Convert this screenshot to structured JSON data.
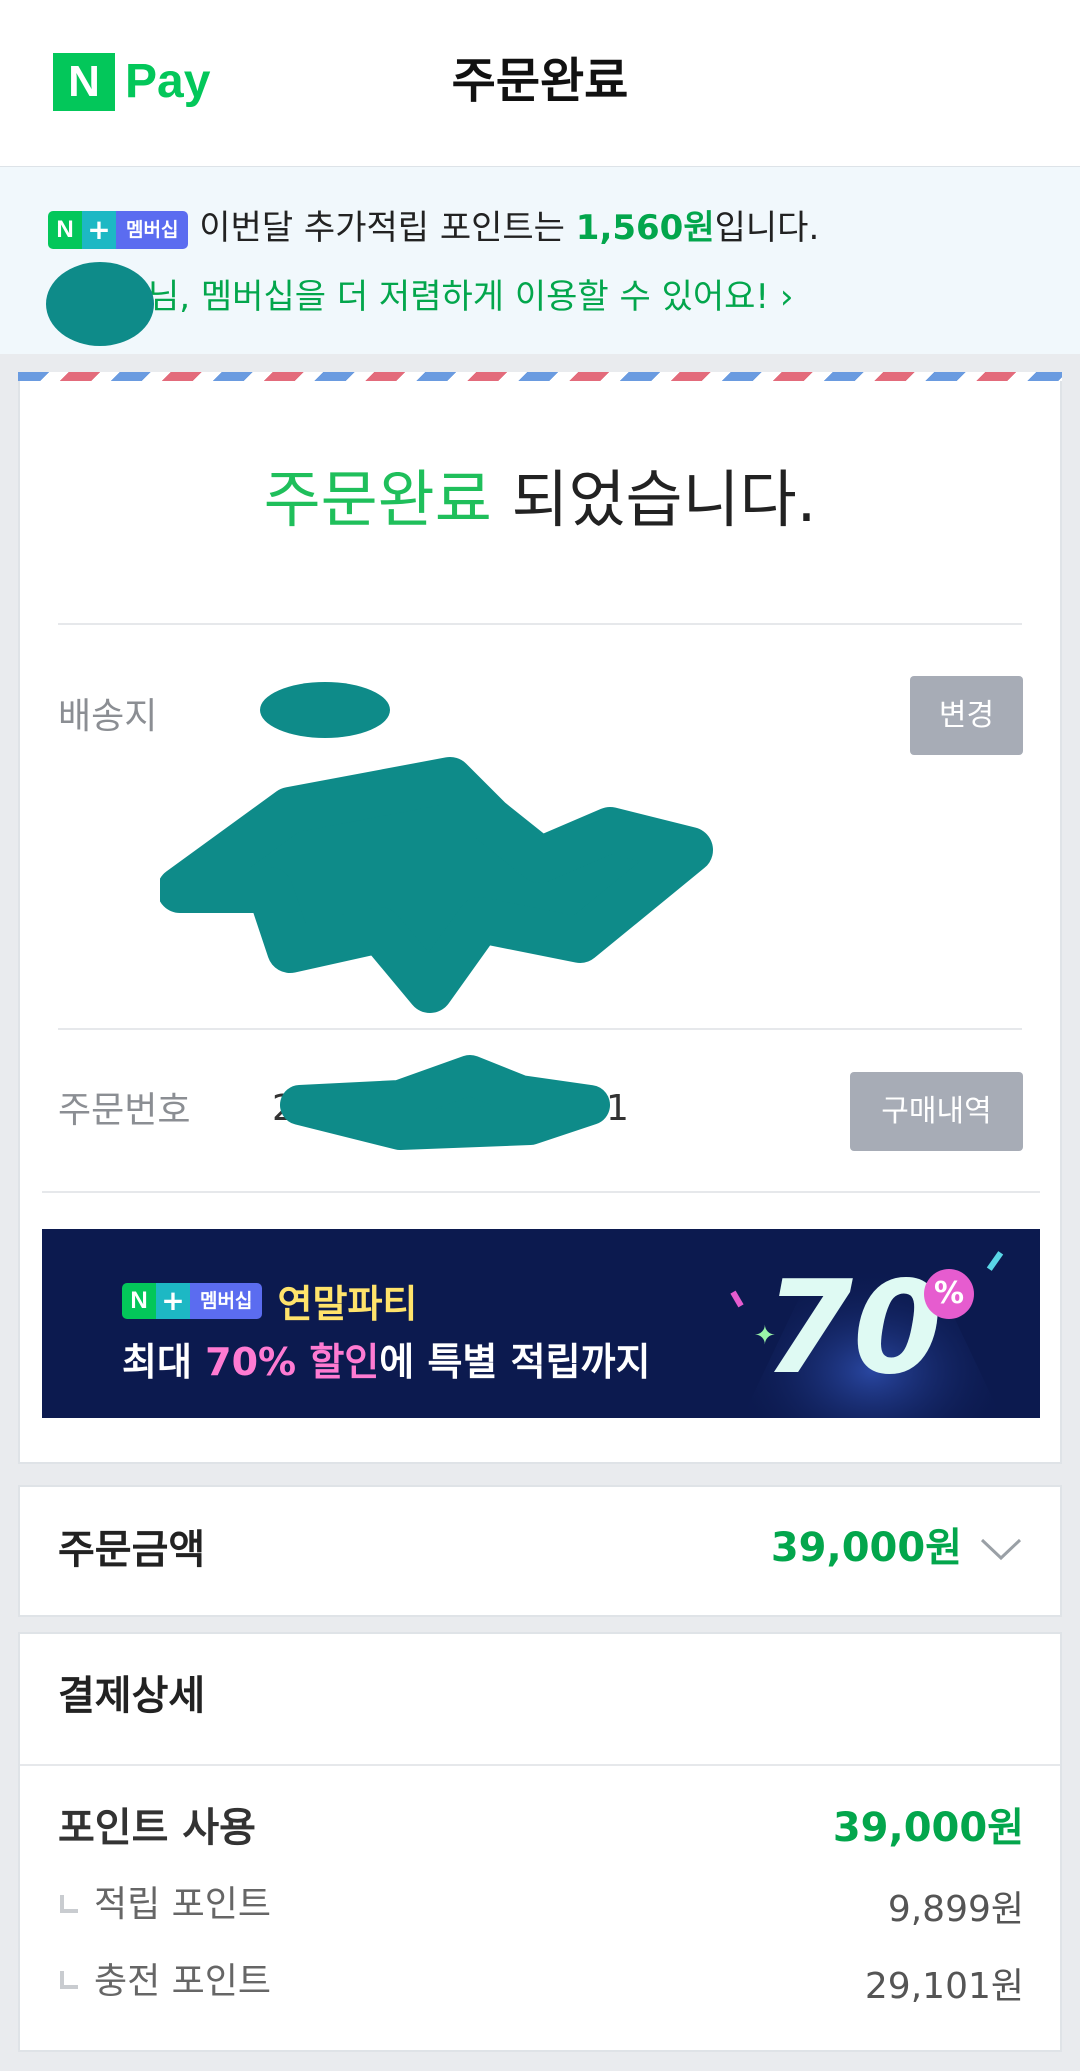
{
  "header": {
    "logo_n": "N",
    "logo_text": "Pay",
    "title": "주문완료"
  },
  "membership": {
    "badge_n": "N",
    "badge_plus": "+",
    "badge_label": "멤버십",
    "points_text_before": "이번달 추가적립 포인트는 ",
    "points_amount": "1,560원",
    "points_text_after": "입니다.",
    "link_text": "님, 멤버십을 더 저렴하게 이용할 수 있어요! ›"
  },
  "order": {
    "title_highlight": "주문완료",
    "title_rest": " 되었습니다.",
    "address_label": "배송지",
    "change_button": "변경",
    "order_number_label": "주문번호",
    "order_number_visible_start": "2",
    "order_number_visible_end": "1",
    "history_button": "구매내역"
  },
  "ad_banner": {
    "badge_n": "N",
    "badge_plus": "+",
    "badge_label": "멤버십",
    "title": "연말파티",
    "line_part1": "최대 ",
    "line_highlight": "70% 할인",
    "line_part2": "에 특별 적립까지",
    "big_number": "70",
    "percent_badge": "%"
  },
  "order_amount": {
    "label": "주문금액",
    "value": "39,000원"
  },
  "payment_detail": {
    "title": "결제상세",
    "points_used_label": "포인트 사용",
    "points_used_value": "39,000원",
    "items": [
      {
        "label": "적립 포인트",
        "value": "9,899원"
      },
      {
        "label": "충전 포인트",
        "value": "29,101원"
      }
    ]
  },
  "colors": {
    "brand_green": "#03c75a",
    "price_green": "#03a64c",
    "redaction": "#0e8b89",
    "ad_background": "#0c1a4f"
  }
}
